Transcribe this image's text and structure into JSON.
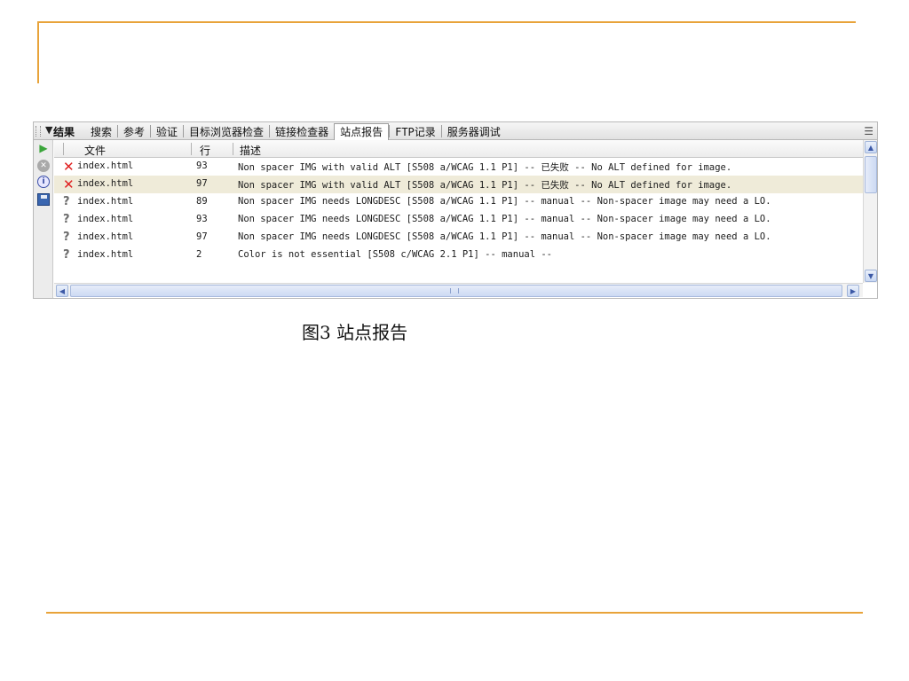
{
  "panel": {
    "group_title": "结果",
    "tabs": [
      {
        "label": "搜索"
      },
      {
        "label": "参考"
      },
      {
        "label": "验证"
      },
      {
        "label": "目标浏览器检查"
      },
      {
        "label": "链接检查器"
      },
      {
        "label": "站点报告",
        "active": true
      },
      {
        "label": "FTP记录"
      },
      {
        "label": "服务器调试"
      }
    ],
    "columns": {
      "file": "文件",
      "line": "行",
      "desc": "描述"
    },
    "rows": [
      {
        "status": "fail",
        "file": "index.html",
        "line": "93",
        "desc": "Non spacer IMG with valid ALT  [S508 a/WCAG 1.1 P1]   -- 已失败 -- No ALT defined for image."
      },
      {
        "status": "fail",
        "file": "index.html",
        "line": "97",
        "desc": "Non spacer IMG with valid ALT  [S508 a/WCAG 1.1 P1]   -- 已失败 -- No ALT defined for image."
      },
      {
        "status": "manual",
        "file": "index.html",
        "line": "89",
        "desc": "Non spacer IMG needs LONGDESC  [S508 a/WCAG 1.1 P1]   -- manual -- Non-spacer image may need a LO."
      },
      {
        "status": "manual",
        "file": "index.html",
        "line": "93",
        "desc": "Non spacer IMG needs LONGDESC  [S508 a/WCAG 1.1 P1]   -- manual -- Non-spacer image may need a LO."
      },
      {
        "status": "manual",
        "file": "index.html",
        "line": "97",
        "desc": "Non spacer IMG needs LONGDESC  [S508 a/WCAG 1.1 P1]   -- manual -- Non-spacer image may need a LO."
      },
      {
        "status": "manual",
        "file": "index.html",
        "line": "2",
        "desc": "Color is not essential  [S508 c/WCAG 2.1 P1]   -- manual --"
      }
    ]
  },
  "caption": "图3 站点报告",
  "colors": {
    "accent_line": "#e8a33a",
    "fail": "#e02020",
    "selected_row": "#efebd9"
  }
}
